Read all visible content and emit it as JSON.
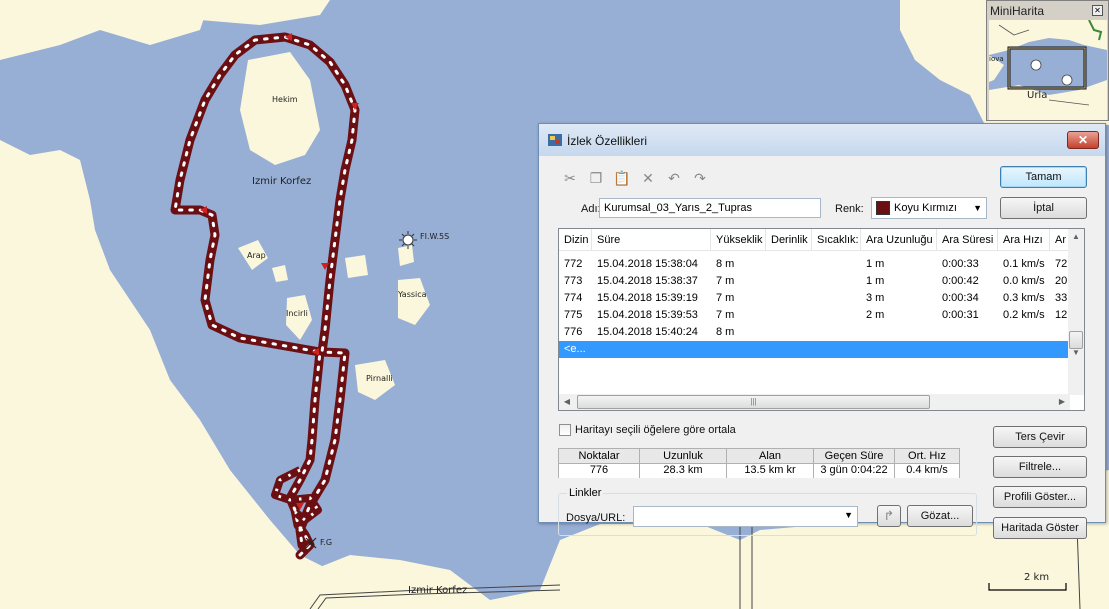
{
  "map": {
    "labels": {
      "hekim": "Hekim",
      "izmir_korfez_1": "Izmir Korfez",
      "arap": "Arap",
      "incirli": "Incirli",
      "flw": "FI.W.5S",
      "yassica": "Yassica",
      "pirnalli": "Pirnalli",
      "fg": "F.G",
      "izmir_korfez_2": "Izmir Korfez"
    },
    "scale_label": "2 km",
    "colors": {
      "water": "#97aed5",
      "land": "#fbf7dc",
      "track": "#6b0f12",
      "dot": "#ffffff"
    }
  },
  "minimap": {
    "title": "MiniHarita",
    "labels": {
      "izmir": "İzmir",
      "urla": "Urla",
      "iova": "iova"
    }
  },
  "dialog": {
    "title": "İzlek Özellikleri",
    "name_label": "Adı:",
    "name_value": "Kurumsal_03_Yarıs_2_Tupras",
    "color_label": "Renk:",
    "color_value": "Koyu Kırmızı",
    "color_swatch": "#6b0f12",
    "ok_label": "Tamam",
    "cancel_label": "İptal",
    "table": {
      "columns": [
        "Dizin",
        "Süre",
        "Yükseklik",
        "Derinlik",
        "Sıcaklık:",
        "Ara Uzunluğu",
        "Ara Süresi",
        "Ara Hızı",
        "Ar"
      ],
      "rows": [
        [
          "772",
          "15.04.2018 15:38:04",
          "8 m",
          "",
          "",
          "1 m",
          "0:00:33",
          "0.1 km/s",
          "72"
        ],
        [
          "773",
          "15.04.2018 15:38:37",
          "7 m",
          "",
          "",
          "1 m",
          "0:00:42",
          "0.0 km/s",
          "20"
        ],
        [
          "774",
          "15.04.2018 15:39:19",
          "7 m",
          "",
          "",
          "3 m",
          "0:00:34",
          "0.3 km/s",
          "33"
        ],
        [
          "775",
          "15.04.2018 15:39:53",
          "7 m",
          "",
          "",
          "2 m",
          "0:00:31",
          "0.2 km/s",
          "12"
        ],
        [
          "776",
          "15.04.2018 15:40:24",
          "8 m",
          "",
          "",
          "",
          "",
          "",
          ""
        ]
      ],
      "new_row": "<e..."
    },
    "center_map_label": "Haritayı seçili öğelere göre ortala",
    "stats": {
      "headers": [
        "Noktalar",
        "Uzunluk",
        "Alan",
        "Geçen Süre",
        "Ort. Hız"
      ],
      "values": [
        "776",
        "28.3 km",
        "13.5 km kr",
        "3 gün 0:04:22",
        "0.4 km/s"
      ]
    },
    "side_buttons": {
      "reverse": "Ters Çevir",
      "filter": "Filtrele...",
      "profile": "Profili Göster...",
      "show_on_map": "Haritada Göster"
    },
    "links": {
      "title": "Linkler",
      "file_url_label": "Dosya/URL:",
      "browse_label": "Gözat..."
    }
  }
}
